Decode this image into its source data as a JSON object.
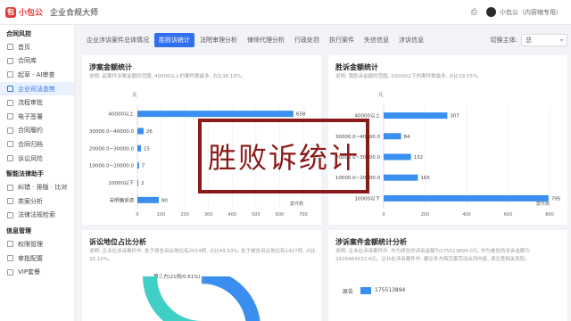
{
  "header": {
    "logo_text": "小包公",
    "app_title": "企业合规大师",
    "printer_icon": "printer-icon",
    "user": "小包公（内容缩专用）"
  },
  "sidebar": {
    "groups": [
      {
        "title": "合同风控",
        "items": [
          {
            "label": "首页",
            "icon": "home-icon"
          },
          {
            "label": "合同库",
            "icon": "folder-icon"
          },
          {
            "label": "起草 · AI审查",
            "icon": "edit-icon"
          },
          {
            "label": "企业司法态势",
            "icon": "chart-icon",
            "active": true
          },
          {
            "label": "流程审批",
            "icon": "flow-icon"
          },
          {
            "label": "电子签署",
            "icon": "sign-icon"
          },
          {
            "label": "合同履约",
            "icon": "doc-icon"
          },
          {
            "label": "合同归档",
            "icon": "archive-icon"
          },
          {
            "label": "诉讼风险",
            "icon": "risk-icon"
          }
        ]
      },
      {
        "title": "智能法律助手",
        "items": [
          {
            "label": "纠错 · 排版 · 比对",
            "icon": "tool-icon"
          },
          {
            "label": "类案分析",
            "icon": "case-icon"
          },
          {
            "label": "法律法规检索",
            "icon": "search-icon"
          }
        ]
      },
      {
        "title": "信息管理",
        "items": [
          {
            "label": "权限管理",
            "icon": "lock-icon"
          },
          {
            "label": "审批配置",
            "icon": "settings-icon"
          },
          {
            "label": "VIP套餐",
            "icon": "vip-icon"
          }
        ]
      }
    ]
  },
  "tabs": [
    "企业涉诉案件总体情况",
    "胜败诉统计",
    "法院审理分析",
    "律师代理分析",
    "行政处罚",
    "执行案件",
    "失信信息",
    "涉诉信息"
  ],
  "active_tab_index": 1,
  "switch": {
    "label": "切换主体:",
    "value": "总"
  },
  "overlay_text": "胜败诉统计",
  "panels": {
    "amount": {
      "title": "涉案金额统计",
      "desc": "说明: 起案件涉案金额的范围, 40000以上的案件数最多, 占比36.18%。"
    },
    "win": {
      "title": "胜诉金额统计",
      "desc": "说明: 我胜诉金额的范围, 10000以下的案件数最多, 占比19.55%。"
    },
    "position": {
      "title": "诉讼地位占比分析",
      "desc": "说明: 企业在涉诉案件中, 处于原告诉讼地位有2014例, 占比49.53%; 处于被告诉讼地位有1427例, 占比35.10%。",
      "donut_label": "第三方(21例/0.61%)"
    },
    "litigation": {
      "title": "涉诉案件金额统计分析",
      "desc": "说明: 企业在涉诉案件中, 作为原告的涉诉金额为175513894.0元, 作为被告的涉诉金额为2429464533.4元。企业在涉诉案件中, 建议多方面完善劳动合同内容, 请注意相关风险。",
      "row_label": "原告",
      "row_value": "175513894"
    }
  },
  "chart_data": [
    {
      "type": "bar",
      "orientation": "horizontal",
      "title": "涉案金额统计",
      "ylabel": "元",
      "xlabel": "案件数",
      "categories": [
        "40000以上",
        "30000.0~40000.0",
        "20000.0~30000.0",
        "10000.0~20000.0",
        "10000以下",
        "未明确诉请"
      ],
      "values": [
        658,
        26,
        15,
        7,
        2,
        90
      ],
      "xlim": [
        0,
        700
      ],
      "xticks": [
        0,
        100,
        200,
        300,
        400,
        500,
        600,
        700
      ],
      "color": "#3a8ef0"
    },
    {
      "type": "bar",
      "orientation": "horizontal",
      "title": "胜诉金额统计",
      "ylabel": "元",
      "xlabel": "案件数",
      "categories": [
        "40000以上",
        "30000.0~40000.0",
        "20000.0~30000.0",
        "10000.0~20000.0",
        "10000以下"
      ],
      "values": [
        307,
        84,
        132,
        165,
        795
      ],
      "xlim": [
        0,
        800
      ],
      "xticks": [
        0,
        200,
        400,
        600,
        800
      ],
      "color": "#3a8ef0"
    }
  ]
}
